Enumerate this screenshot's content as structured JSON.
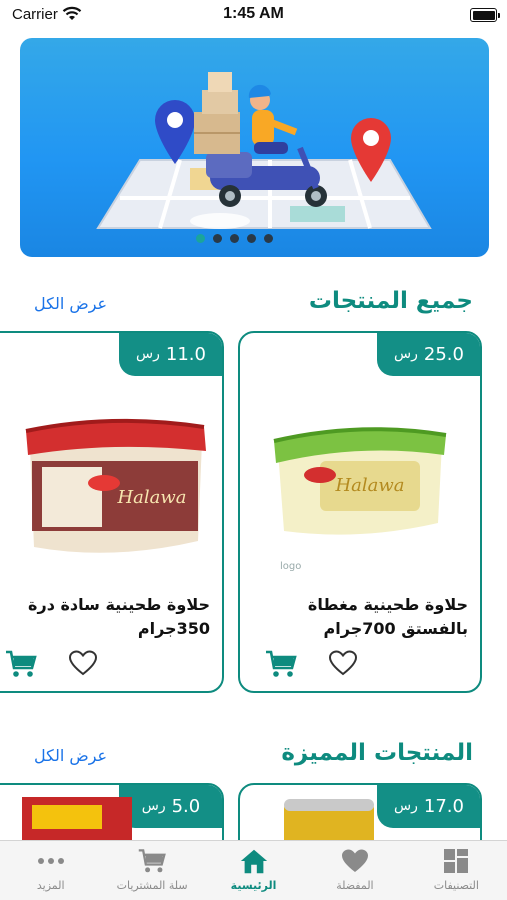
{
  "status_bar": {
    "carrier": "Carrier",
    "time": "1:45 AM"
  },
  "banner": {
    "slides_count": 5,
    "active_slide": 0
  },
  "sections": [
    {
      "title": "جميع المنتجات",
      "see_all": "عرض الكل",
      "products": [
        {
          "name": "حلاوة طحينية مغطاة بالفستق 700جرام",
          "price": "25.0",
          "currency": "رس"
        },
        {
          "name": "حلاوة طحينية سادة درة 350جرام",
          "price": "11.0",
          "currency": "رس"
        }
      ]
    },
    {
      "title": "المنتجات المميزة",
      "see_all": "عرض الكل",
      "products": [
        {
          "price": "17.0",
          "currency": "رس"
        },
        {
          "price": "5.0",
          "currency": "رس"
        }
      ]
    }
  ],
  "tab_bar": {
    "items": [
      {
        "label": "التصنيفات",
        "icon": "grid-icon"
      },
      {
        "label": "المفضلة",
        "icon": "heart-icon"
      },
      {
        "label": "الرئيسية",
        "icon": "home-icon",
        "active": true
      },
      {
        "label": "سلة المشتريات",
        "icon": "cart-icon"
      },
      {
        "label": "المزيد",
        "icon": "more-icon"
      }
    ]
  },
  "colors": {
    "accent": "#0e8b7f",
    "link": "#1a73e8",
    "banner": "#2196f3"
  }
}
